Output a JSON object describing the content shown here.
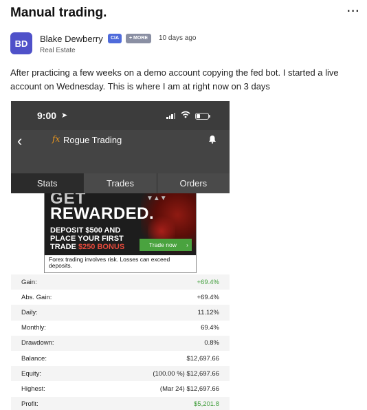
{
  "post": {
    "title": "Manual trading.",
    "more_menu": "···",
    "author": {
      "initials": "BD",
      "name": "Blake Dewberry",
      "badge": "CIA",
      "more_badge": "+ MORE",
      "subtitle": "Real Estate"
    },
    "time": "10 days ago",
    "body": "After practicing a few weeks on a demo account copying the fed bot. I started a live account on Wednesday. This is where I am at right now on 3 days"
  },
  "phone": {
    "clock": "9:00",
    "app_title": "Rogue Trading",
    "fx_logo": "fx",
    "tabs": [
      "Stats",
      "Trades",
      "Orders"
    ],
    "active_tab": "Stats",
    "ad": {
      "headline1": "GET",
      "headline2": "REWARDED.",
      "line1": "DEPOSIT $500 AND",
      "line2": "PLACE YOUR FIRST",
      "line3_prefix": "TRADE ",
      "line3_accent": "$250 BONUS",
      "cta": "Trade now",
      "disclaimer": "Forex trading involves risk. Losses can exceed deposits."
    },
    "stats": [
      {
        "label": "Gain:",
        "value": "+69.4%",
        "positive": true
      },
      {
        "label": "Abs. Gain:",
        "value": "+69.4%",
        "positive": false
      },
      {
        "label": "Daily:",
        "value": "11.12%",
        "positive": false
      },
      {
        "label": "Monthly:",
        "value": "69.4%",
        "positive": false
      },
      {
        "label": "Drawdown:",
        "value": "0.8%",
        "positive": false
      },
      {
        "label": "Balance:",
        "value": "$12,697.66",
        "positive": false
      },
      {
        "label": "Equity:",
        "value": "(100.00 %) $12,697.66",
        "positive": false
      },
      {
        "label": "Highest:",
        "value": "(Mar 24) $12,697.66",
        "positive": false
      },
      {
        "label": "Profit:",
        "value": "$5,201.8",
        "positive": true
      }
    ]
  },
  "colors": {
    "avatar": "#4f51c9",
    "badge_cia": "#4f6bdb",
    "positive": "#3f9d3a",
    "ad_accent": "#e84a3c",
    "cta": "#4aa33f"
  }
}
